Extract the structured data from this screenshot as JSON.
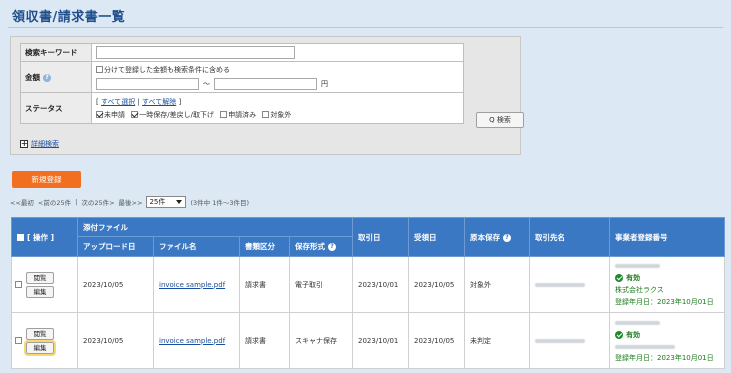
{
  "page": {
    "title": "領収書/請求書一覧"
  },
  "search": {
    "keyword_label": "検索キーワード",
    "keyword_value": "",
    "amount_label": "金額",
    "amount_split_label": "分けて登録した金額も検索条件に含める",
    "amount_tilde": "～",
    "amount_unit": "円",
    "status_label": "ステータス",
    "select_all": "すべて選択",
    "separator": "|",
    "deselect_all": "すべて解除",
    "bracket_open": "[",
    "bracket_close": "]",
    "status_options": [
      {
        "label": "未申請",
        "checked": true
      },
      {
        "label": "一時保存/差戻し/取下げ",
        "checked": true
      },
      {
        "label": "申請済み",
        "checked": false
      },
      {
        "label": "対象外",
        "checked": false
      }
    ],
    "search_button": "Q 検索",
    "advanced_plus": "+",
    "advanced_link": "詳細検索"
  },
  "new_button": "新規登録",
  "pager": {
    "first": "<<最初",
    "prev": "<前の25件",
    "sep": "|",
    "next": "次の25件>",
    "last": "最後>>",
    "per_page": "25件",
    "summary": "(3件中 1件～3件目)"
  },
  "table": {
    "headers": {
      "action": "[ 操作 ]",
      "attachment": "添付ファイル",
      "upload_date": "アップロード日",
      "file_name": "ファイル名",
      "doc_type": "書類区分",
      "storage_type": "保存形式",
      "transaction_date": "取引日",
      "received_date": "受領日",
      "original_storage": "原本保存",
      "counterparty": "取引先名",
      "registration_no": "事業者登録番号"
    },
    "view_button": "閲覧",
    "edit_button": "編集",
    "rows": [
      {
        "upload_date": "2023/10/05",
        "file_name": "invoice sample.pdf",
        "doc_type": "請求書",
        "storage_type": "電子取引",
        "transaction_date": "2023/10/01",
        "received_date": "2023/10/05",
        "original_storage": "対象外",
        "reg_status": "有効",
        "reg_company": "株式会社ラクス",
        "reg_date": "登録年月日：2023年10月01日"
      },
      {
        "upload_date": "2023/10/05",
        "file_name": "invoice sample.pdf",
        "doc_type": "請求書",
        "storage_type": "スキャナ保存",
        "transaction_date": "2023/10/01",
        "received_date": "2023/10/05",
        "original_storage": "未判定",
        "reg_status": "有効",
        "reg_company": "",
        "reg_date": "登録年月日：2023年10月01日"
      }
    ]
  }
}
